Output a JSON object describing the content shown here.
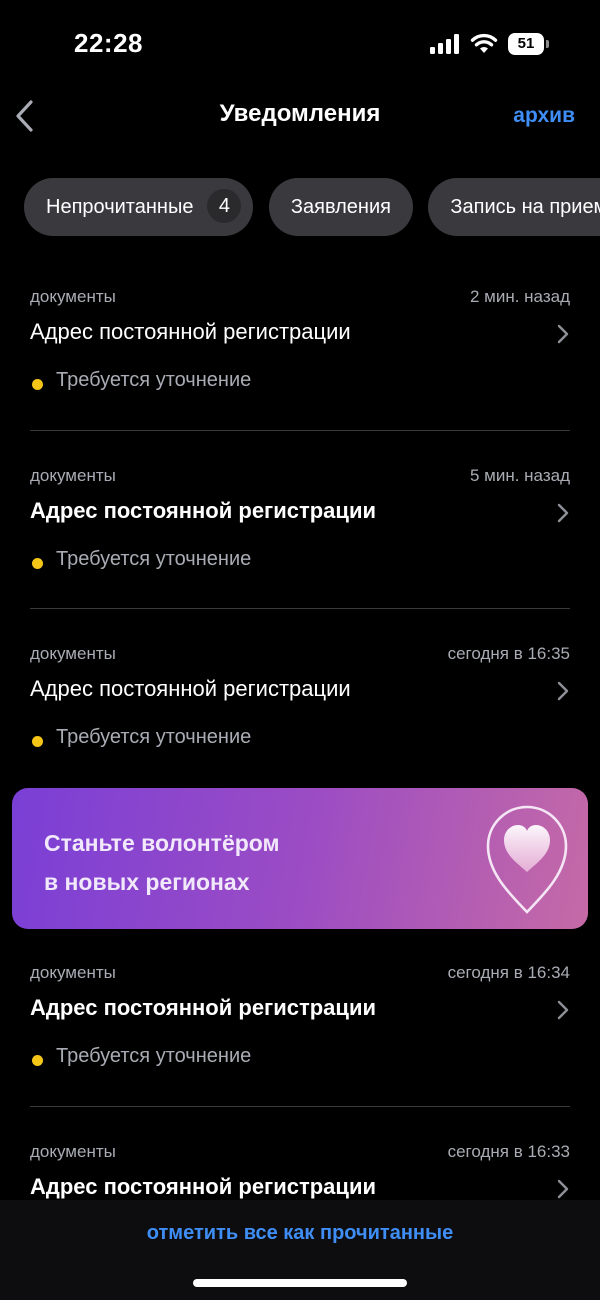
{
  "status_bar": {
    "time": "22:28",
    "battery": "51"
  },
  "header": {
    "title": "Уведомления",
    "archive_label": "архив"
  },
  "filters": [
    {
      "label": "Непрочитанные",
      "count": "4"
    },
    {
      "label": "Заявления"
    },
    {
      "label": "Запись на прием"
    }
  ],
  "notifications": [
    {
      "category": "документы",
      "time": "2 мин. назад",
      "title": "Адрес постоянной регистрации",
      "status": "Требуется уточнение"
    },
    {
      "category": "документы",
      "time": "5 мин. назад",
      "title": "Адрес постоянной регистрации",
      "status": "Требуется уточнение"
    },
    {
      "category": "документы",
      "time": "сегодня в 16:35",
      "title": "Адрес постоянной регистрации",
      "status": "Требуется уточнение"
    },
    {
      "category": "документы",
      "time": "сегодня в 16:34",
      "title": "Адрес постоянной регистрации",
      "status": "Требуется уточнение"
    },
    {
      "category": "документы",
      "time": "сегодня в 16:33",
      "title": "Адрес постоянной регистрации",
      "status": ""
    }
  ],
  "promo": {
    "line1": "Станьте волонтёром",
    "line2": "в новых регионах",
    "icon": "heart-location-pin-icon"
  },
  "footer": {
    "mark_all_label": "отметить все как прочитанные"
  },
  "colors": {
    "accent": "#3f8ef5",
    "status_dot": "#f5c518",
    "chip_bg": "#3a3a3e",
    "background": "#000000"
  }
}
